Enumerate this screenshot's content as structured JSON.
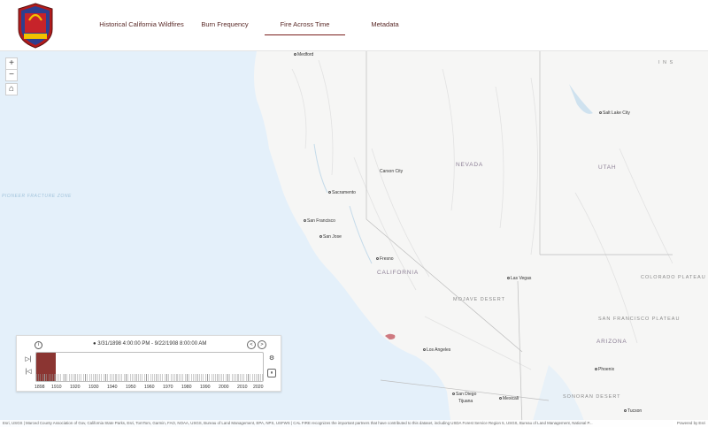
{
  "header": {
    "logo": {
      "line1": "CALIFORNIA DEPARTMENT OF FORESTRY",
      "title": "CAL FIRE",
      "since": "SINCE 1885"
    },
    "tabs": [
      {
        "label": "Historical California Wildfires",
        "active": false
      },
      {
        "label": "Burn Frequency",
        "active": false
      },
      {
        "label": "Fire Across Time",
        "active": true
      },
      {
        "label": "Metadata",
        "active": false
      }
    ]
  },
  "map_controls": {
    "zoom_in": "+",
    "zoom_out": "−",
    "home": "⌂"
  },
  "map_labels": {
    "cities": [
      "Medford",
      "Salt Lake City",
      "Carson City",
      "Sacramento",
      "San Francisco",
      "San Jose",
      "Fresno",
      "Las Vegas",
      "Los Angeles",
      "San Diego",
      "Mexicali",
      "Phoenix",
      "Tucson",
      "Tijuana"
    ],
    "regions": [
      "NEVADA",
      "UTAH",
      "CALIFORNIA",
      "ARIZONA",
      "COLORADO PLATEAU",
      "MOJAVE DESERT",
      "SONORAN DESERT",
      "SAN FRANCISCO PLATEAU"
    ],
    "ocean": "PIONEER FRACTURE ZONE",
    "edge_text": "I N S"
  },
  "time_slider": {
    "info_icon": "i",
    "range_label": "3/31/1898 4:00:00 PM - 9/22/1908 8:00:00 AM",
    "range_marker": "●",
    "years": [
      "1898",
      "1910",
      "1920",
      "1930",
      "1940",
      "1950",
      "1960",
      "1970",
      "1980",
      "1990",
      "2000",
      "2010",
      "2020"
    ],
    "fill_fraction": 0.085,
    "next_label": "▷|",
    "prev_label": "|◁",
    "pause_label": "⏸",
    "settings_label": "⚙"
  },
  "attribution": {
    "text": "Esri, USGS | Marced County Association of Gov, California State Parks, Esri, TomTom, Garmin, FAO, NOAA, USGS, Bureau of Land Management, EPA, NPS, USFWS | CAL FIRE recognizes the important partners that have contributed to this dataset, including USDA Forest Service Region 5, USGS, Bureau of Land Management, National P...",
    "powered_by": "Powered by Esri"
  },
  "colors": {
    "accent": "#7a1f1c",
    "fire_fill": "#8b3532",
    "ocean": "#e4f0fa",
    "land": "#f6f6f5"
  }
}
